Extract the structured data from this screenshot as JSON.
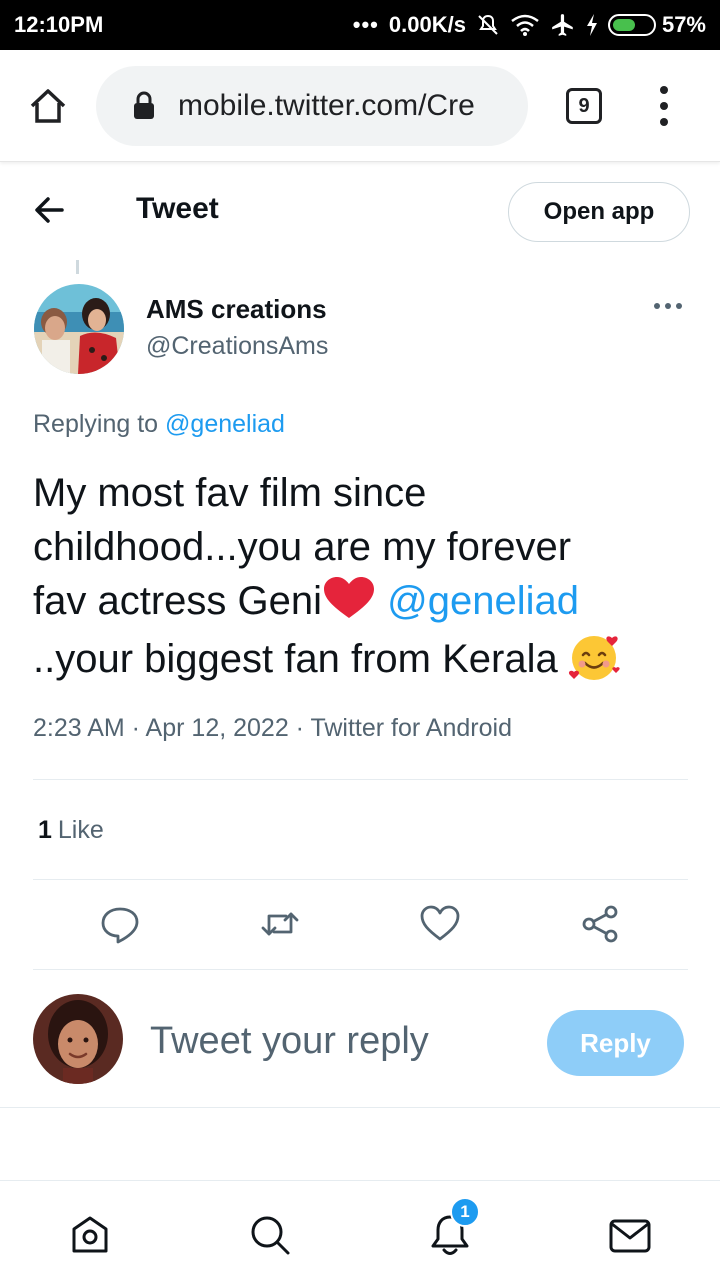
{
  "status_bar": {
    "time": "12:10PM",
    "network_speed": "0.00K/s",
    "battery_percent": "57%",
    "battery_level": 0.57,
    "icons": [
      "dots-icon",
      "mute-icon",
      "wifi-icon",
      "airplane-icon",
      "charging-icon",
      "battery-icon"
    ]
  },
  "browser": {
    "url": "mobile.twitter.com/Cre",
    "tab_count": "9",
    "icons": [
      "home-icon",
      "lock-icon",
      "more-vertical-icon"
    ]
  },
  "header": {
    "title": "Tweet",
    "open_app_label": "Open app"
  },
  "tweet": {
    "author_name": "AMS creations",
    "author_handle": "@CreationsAms",
    "replying_prefix": "Replying to",
    "replying_to": "@geneliad",
    "text_line1": "My most fav film since",
    "text_line2": "childhood...you are my forever",
    "text_line3_pre": "fav actress Geni",
    "text_mention": "@geneliad",
    "text_line4": "..your biggest fan from Kerala",
    "meta": "2:23 AM · Apr 12, 2022 · Twitter for Android",
    "like_count": "1",
    "like_label": "Like"
  },
  "composer": {
    "placeholder": "Tweet your reply",
    "reply_label": "Reply"
  },
  "bottom_nav": {
    "notification_badge": "1",
    "items": [
      "home-icon",
      "search-icon",
      "notifications-icon",
      "messages-icon"
    ]
  },
  "colors": {
    "accent": "#1d9bf0",
    "reply_button_disabled": "#8ecdf8",
    "secondary_text": "#536471"
  }
}
